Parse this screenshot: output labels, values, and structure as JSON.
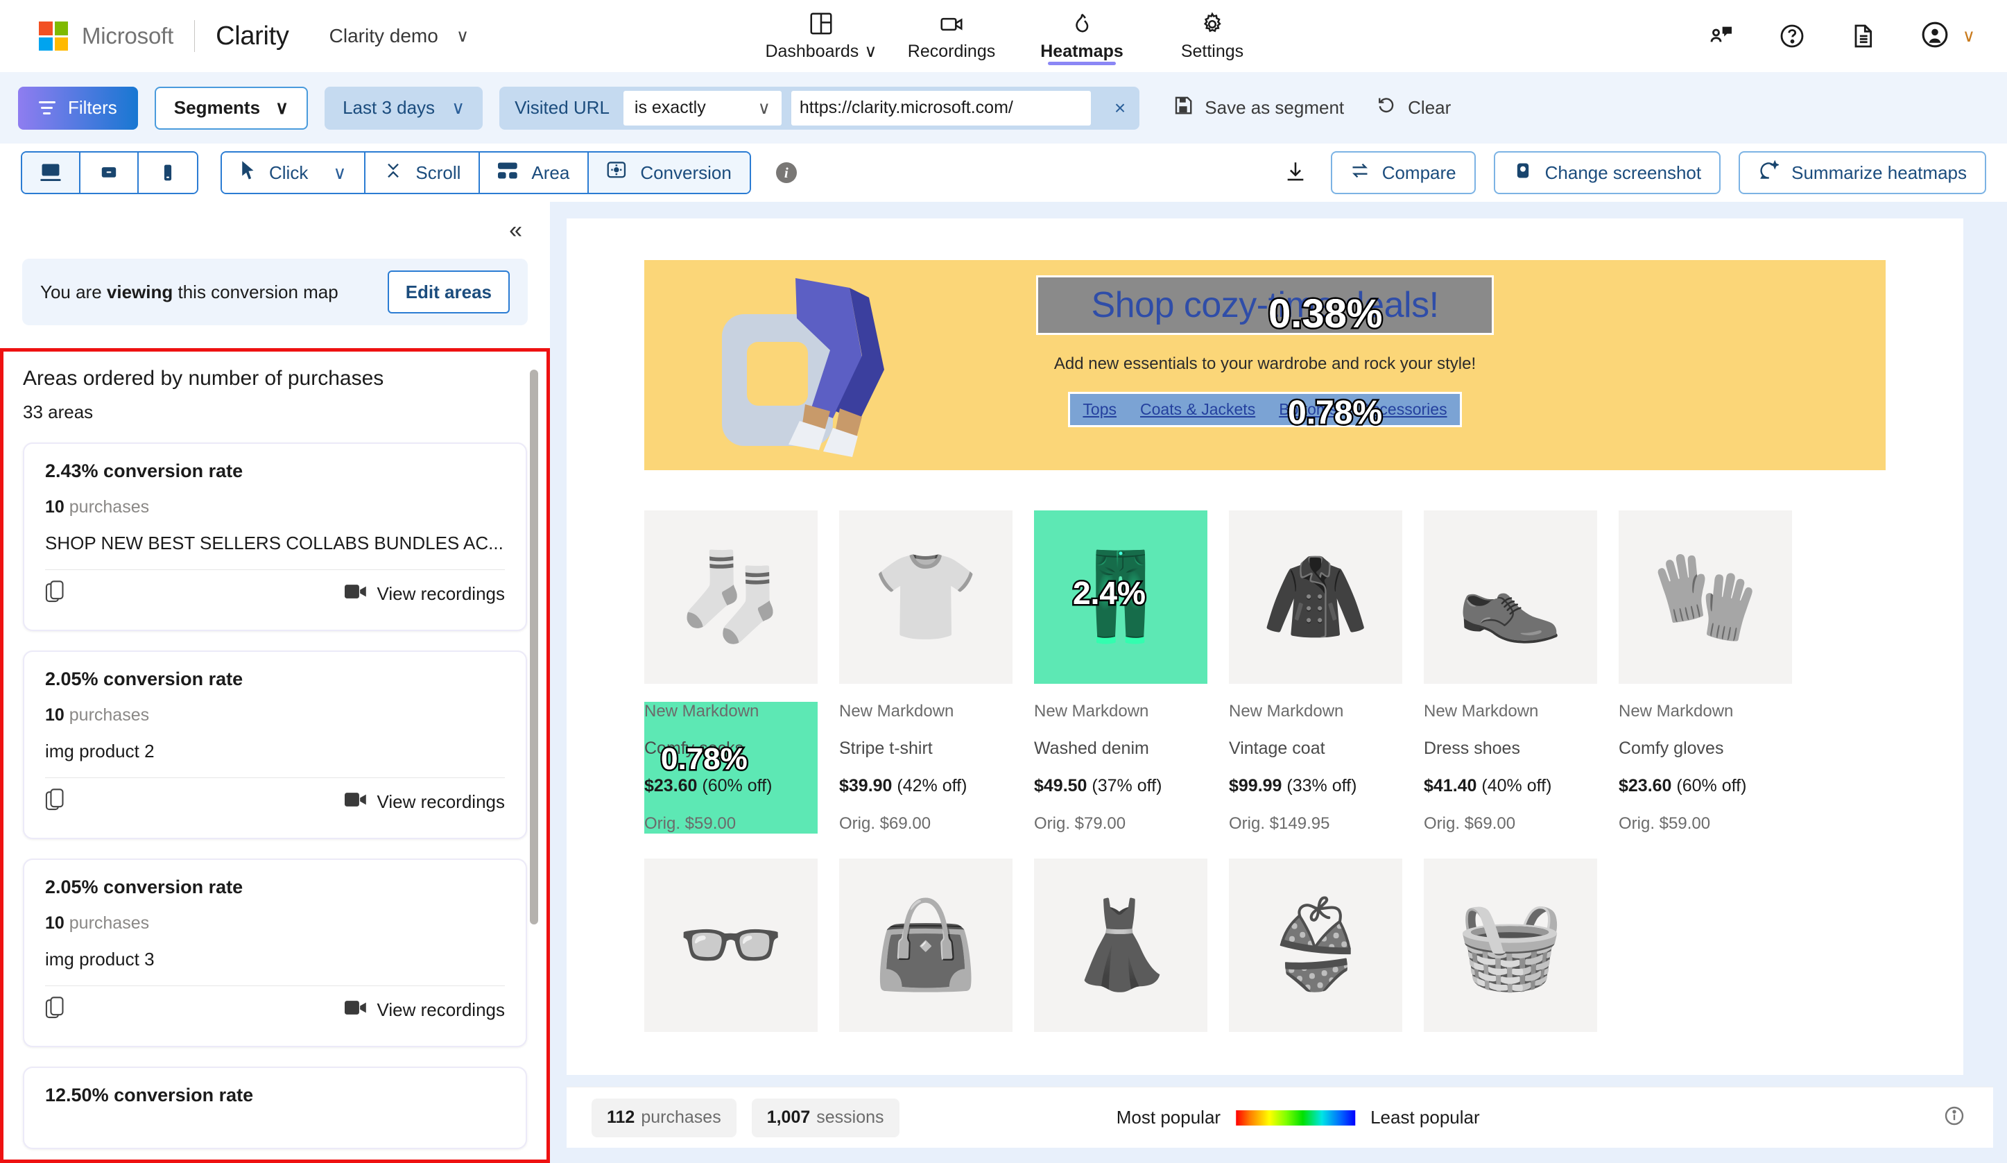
{
  "brand": {
    "microsoft": "Microsoft",
    "product": "Clarity",
    "project": "Clarity demo"
  },
  "nav": {
    "tabs": [
      {
        "label": "Dashboards",
        "icon": "dashboard-icon",
        "active": false,
        "caret": "∨"
      },
      {
        "label": "Recordings",
        "icon": "video-camera-icon",
        "active": false
      },
      {
        "label": "Heatmaps",
        "icon": "flame-icon",
        "active": true
      },
      {
        "label": "Settings",
        "icon": "gear-icon",
        "active": false
      }
    ],
    "right_icons": [
      "feedback-person-icon",
      "help-question-icon",
      "documentation-icon",
      "account-avatar-icon"
    ]
  },
  "filterbar": {
    "filters_label": "Filters",
    "segments_label": "Segments",
    "date_range": "Last 3 days",
    "url_filter": {
      "label": "Visited URL",
      "operator": "is exactly",
      "value": "https://clarity.microsoft.com/",
      "remove": "×"
    },
    "save_segment_label": "Save as segment",
    "clear_label": "Clear"
  },
  "toolbar": {
    "devices": [
      {
        "name": "desktop",
        "selected": true
      },
      {
        "name": "tablet",
        "selected": false
      },
      {
        "name": "mobile",
        "selected": false
      }
    ],
    "modes": [
      {
        "label": "Click",
        "icon": "cursor-icon",
        "selected": false,
        "has_caret": true
      },
      {
        "label": "Scroll",
        "icon": "scroll-icon",
        "selected": false
      },
      {
        "label": "Area",
        "icon": "area-grid-icon",
        "selected": false
      },
      {
        "label": "Conversion",
        "icon": "conversion-icon",
        "selected": true
      }
    ],
    "info_tooltip": "i",
    "download_icon": "download-icon",
    "compare_label": "Compare",
    "change_screenshot_label": "Change screenshot",
    "summarize_label": "Summarize heatmaps"
  },
  "leftpanel": {
    "collapse_icon": "«",
    "viewing_prefix": "You are ",
    "viewing_bold": "viewing",
    "viewing_suffix": " this conversion map",
    "edit_areas_label": "Edit areas",
    "areas_title": "Areas ordered by number of purchases",
    "areas_count": "33 areas",
    "view_recordings_label": "View recordings",
    "cards": [
      {
        "rate": "2.43% conversion rate",
        "purchases_num": "10",
        "purchases_word": "purchases",
        "area_name": "SHOP NEW BEST SELLERS COLLABS BUNDLES AC..."
      },
      {
        "rate": "2.05% conversion rate",
        "purchases_num": "10",
        "purchases_word": "purchases",
        "area_name": "img product 2"
      },
      {
        "rate": "2.05% conversion rate",
        "purchases_num": "10",
        "purchases_word": "purchases",
        "area_name": "img product 3"
      },
      {
        "rate": "12.50% conversion rate",
        "purchases_num": "",
        "purchases_word": "",
        "area_name": ""
      }
    ]
  },
  "page_preview": {
    "hero": {
      "headline": "Shop cozy-time deals!",
      "subhead": "Add new essentials to your wardrobe and rock your style!",
      "links": [
        "Tops",
        "Coats & Jackets",
        "Bottoms",
        "Accessories"
      ],
      "overlay_headline_pct": "0.38%",
      "overlay_links_pct": "0.78%"
    },
    "products_row1": [
      {
        "badge": "New Markdown",
        "name": "Comfy socks",
        "price": "$23.60",
        "discount": "(60% off)",
        "orig": "Orig. $59.00",
        "emoji": "🧦",
        "img_hot": false,
        "meta_hot": true,
        "overlay": "0.78%"
      },
      {
        "badge": "New Markdown",
        "name": "Stripe t-shirt",
        "price": "$39.90",
        "discount": "(42% off)",
        "orig": "Orig. $69.00",
        "emoji": "👕",
        "img_hot": false,
        "meta_hot": false,
        "overlay": ""
      },
      {
        "badge": "New Markdown",
        "name": "Washed denim",
        "price": "$49.50",
        "discount": "(37% off)",
        "orig": "Orig. $79.00",
        "emoji": "👖",
        "img_hot": true,
        "meta_hot": false,
        "overlay": "2.4%"
      },
      {
        "badge": "New Markdown",
        "name": "Vintage coat",
        "price": "$99.99",
        "discount": "(33% off)",
        "orig": "Orig. $149.95",
        "emoji": "🧥",
        "img_hot": false,
        "meta_hot": false,
        "overlay": ""
      },
      {
        "badge": "New Markdown",
        "name": "Dress shoes",
        "price": "$41.40",
        "discount": "(40% off)",
        "orig": "Orig. $69.00",
        "emoji": "👞",
        "img_hot": false,
        "meta_hot": false,
        "overlay": ""
      },
      {
        "badge": "New Markdown",
        "name": "Comfy gloves",
        "price": "$23.60",
        "discount": "(60% off)",
        "orig": "Orig. $59.00",
        "emoji": "🧤",
        "img_hot": false,
        "meta_hot": false,
        "overlay": ""
      }
    ],
    "products_row2": [
      {
        "emoji": "👓"
      },
      {
        "emoji": "👜"
      },
      {
        "emoji": "👗"
      },
      {
        "emoji": "👙"
      },
      {
        "emoji": "🧺"
      }
    ]
  },
  "statusbar": {
    "purchases_num": "112",
    "purchases_word": "purchases",
    "sessions_num": "1,007",
    "sessions_word": "sessions",
    "legend_most": "Most popular",
    "legend_least": "Least popular",
    "info_icon": "info-icon"
  },
  "colors": {
    "accent_blue": "#2b7cd3",
    "filter_gradient_start": "#8f7df0",
    "filter_gradient_end": "#1877d2",
    "heat_green": "#5de8b4",
    "hero_yellow": "#fbd678",
    "highlight_border": "#ee1111",
    "active_tab_underline": "#8b87f5"
  }
}
